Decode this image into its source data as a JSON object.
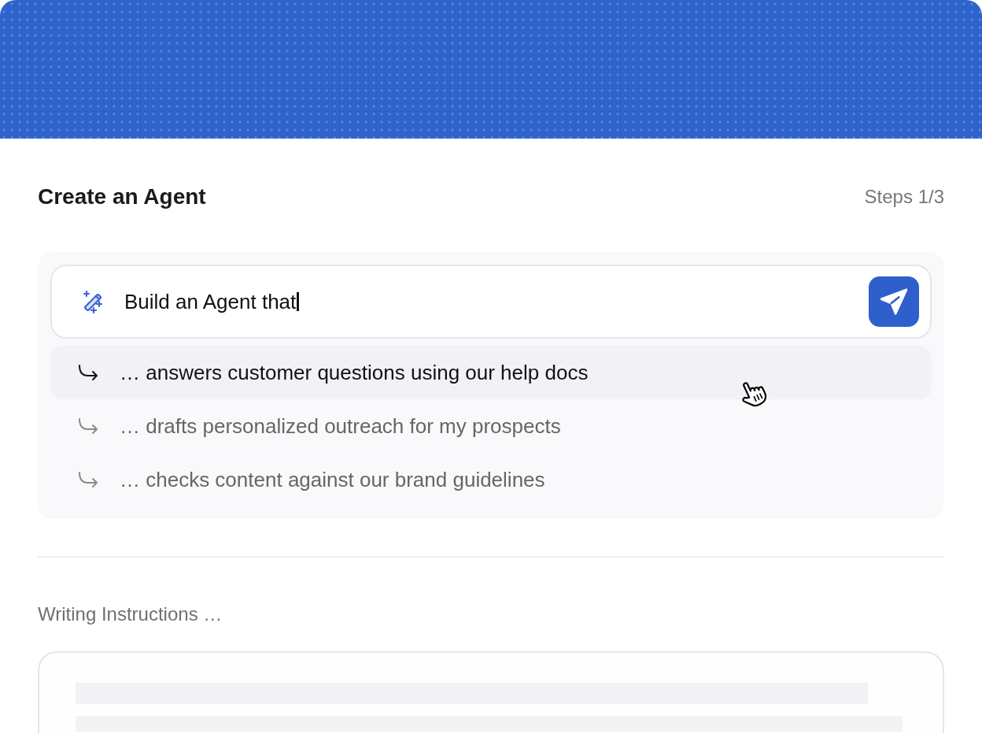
{
  "title": "Create an Agent",
  "steps": "Steps 1/3",
  "prompt": {
    "value": "Build an Agent that",
    "focused": true
  },
  "suggestions": [
    {
      "text": "… answers customer questions using our help docs",
      "selected": true
    },
    {
      "text": "… drafts personalized outreach for my prospects",
      "selected": false
    },
    {
      "text": "… checks content against our brand guidelines",
      "selected": false
    }
  ],
  "instructions": {
    "label": "Writing Instructions …"
  }
}
